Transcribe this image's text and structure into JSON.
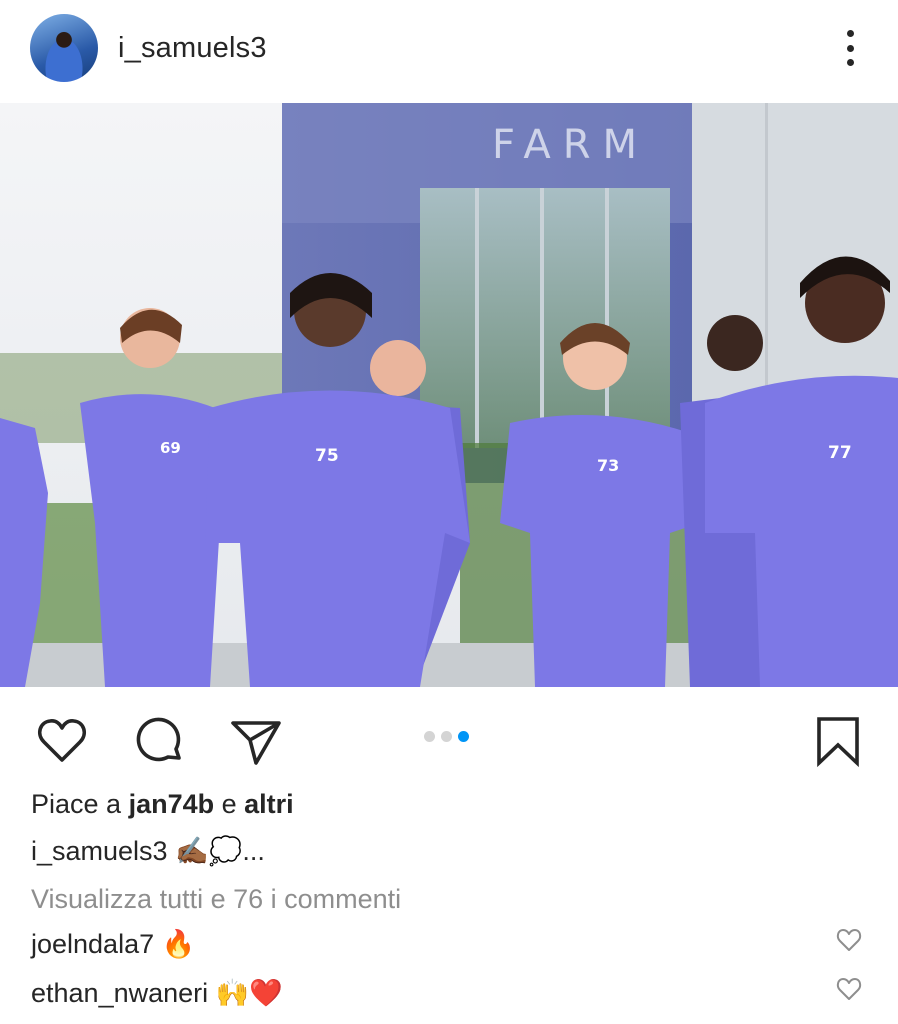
{
  "post": {
    "username": "i_samuels3",
    "avatar_icon": "profile-avatar",
    "more_icon": "more-vertical-icon",
    "photo": {
      "sign_text": "FARM",
      "shirt_numbers": [
        "69",
        "75",
        "73",
        "77"
      ],
      "shirt_color": "#7d78e6"
    },
    "carousel": {
      "count": 3,
      "active_index": 2
    },
    "actions": {
      "like_icon": "heart-icon",
      "comment_icon": "comment-icon",
      "share_icon": "send-icon",
      "save_icon": "bookmark-icon"
    },
    "likes": {
      "prefix": "Piace a ",
      "user": "jan74b",
      "connector": " e ",
      "others": "altri"
    },
    "caption": {
      "username": "i_samuels3",
      "text": " ✍🏾💭..."
    },
    "view_all_comments": "Visualizza tutti e 76 i commenti",
    "comments": [
      {
        "username": "joelndala7",
        "text": " 🔥"
      },
      {
        "username": "ethan_nwaneri",
        "text": " 🙌❤️"
      }
    ]
  },
  "colors": {
    "text": "#262626",
    "secondary": "#8e8e8e",
    "accent": "#0095f6"
  }
}
